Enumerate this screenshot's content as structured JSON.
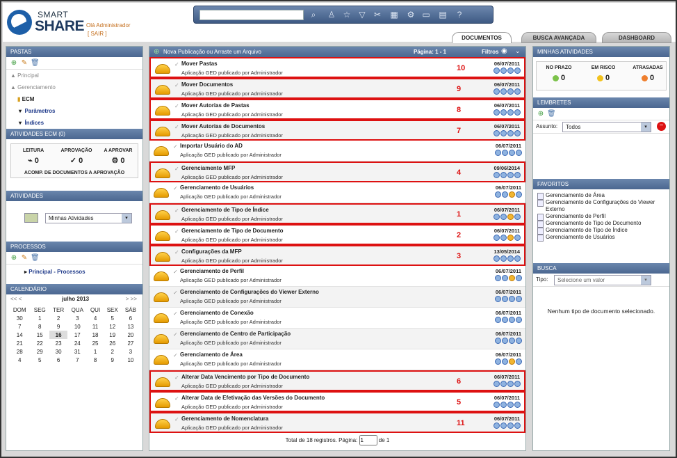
{
  "header": {
    "logo_top": "SMART",
    "logo_bottom": "SHARE",
    "greeting": "Olá Administrador",
    "logout": "[ SAIR ]"
  },
  "tabs": [
    "DOCUMENTOS",
    "BUSCA AVANÇADA",
    "DASHBOARD"
  ],
  "left": {
    "pastas_title": "PASTAS",
    "tree": [
      "Principal",
      "Gerenciamento",
      "ECM",
      "Parâmetros",
      "Índices"
    ],
    "ecm_title": "ATIVIDADES ECM (0)",
    "ecm_stats": [
      {
        "label": "LEITURA",
        "value": "0"
      },
      {
        "label": "APROVAÇÃO",
        "value": "0"
      },
      {
        "label": "A APROVAR",
        "value": "0"
      }
    ],
    "ecm_footer": "ACOMP. DE DOCUMENTOS A APROVAÇÃO",
    "atividades_title": "ATIVIDADES",
    "atividades_select": "Minhas Atividades",
    "processos_title": "PROCESSOS",
    "processos_item": "Principal - Processos",
    "calendario_title": "CALENDÁRIO",
    "cal_month": "julho 2013",
    "cal_prev": "<< <",
    "cal_next": "> >>",
    "cal_days": [
      "DOM",
      "SEG",
      "TER",
      "QUA",
      "QUI",
      "SEX",
      "SÁB"
    ],
    "cal_weeks": [
      [
        "30",
        "1",
        "2",
        "3",
        "4",
        "5",
        "6"
      ],
      [
        "7",
        "8",
        "9",
        "10",
        "11",
        "12",
        "13"
      ],
      [
        "14",
        "15",
        "16",
        "17",
        "18",
        "19",
        "20"
      ],
      [
        "21",
        "22",
        "23",
        "24",
        "25",
        "26",
        "27"
      ],
      [
        "28",
        "29",
        "30",
        "31",
        "1",
        "2",
        "3"
      ],
      [
        "4",
        "5",
        "6",
        "7",
        "8",
        "9",
        "10"
      ]
    ],
    "cal_today": "16"
  },
  "main": {
    "new_pub": "Nova Publicação ou Arraste um Arquivo",
    "page_label": "Página:  1 - 1",
    "filters": "Filtros",
    "rows": [
      {
        "title": "Mover Pastas",
        "sub": "Aplicação GED publicado por Administrador",
        "num": "10",
        "date": "06/07/2011",
        "hl": true,
        "warn": false
      },
      {
        "title": "Mover Documentos",
        "sub": "Aplicação GED publicado por Administrador",
        "num": "9",
        "date": "06/07/2011",
        "hl": true,
        "warn": false
      },
      {
        "title": "Mover Autorias de Pastas",
        "sub": "Aplicação GED publicado por Administrador",
        "num": "8",
        "date": "06/07/2011",
        "hl": true,
        "warn": false
      },
      {
        "title": "Mover Autorias de Documentos",
        "sub": "Aplicação GED publicado por Administrador",
        "num": "7",
        "date": "06/07/2011",
        "hl": true,
        "warn": false
      },
      {
        "title": "Importar Usuário do AD",
        "sub": "Aplicação GED publicado por Administrador",
        "num": "",
        "date": "06/07/2011",
        "hl": false,
        "warn": false
      },
      {
        "title": "Gerenciamento MFP",
        "sub": "Aplicação GED publicado por Administrador",
        "num": "4",
        "date": "09/06/2014",
        "hl": true,
        "warn": false
      },
      {
        "title": "Gerenciamento de Usuários",
        "sub": "Aplicação GED publicado por Administrador",
        "num": "",
        "date": "06/07/2011",
        "hl": false,
        "warn": true
      },
      {
        "title": "Gerenciamento de Tipo de Índice",
        "sub": "Aplicação GED publicado por Administrador",
        "num": "1",
        "date": "06/07/2011",
        "hl": true,
        "warn": true
      },
      {
        "title": "Gerenciamento de Tipo de Documento",
        "sub": "Aplicação GED publicado por Administrador",
        "num": "2",
        "date": "06/07/2011",
        "hl": true,
        "warn": true
      },
      {
        "title": "Configurações da MFP",
        "sub": "Aplicação GED publicado por Administrador",
        "num": "3",
        "date": "13/05/2014",
        "hl": true,
        "warn": false
      },
      {
        "title": "Gerenciamento de Perfil",
        "sub": "Aplicação GED publicado por Administrador",
        "num": "",
        "date": "06/07/2011",
        "hl": false,
        "warn": true
      },
      {
        "title": "Gerenciamento de Configurações do Viewer Externo",
        "sub": "Aplicação GED publicado por Administrador",
        "num": "",
        "date": "06/07/2011",
        "hl": false,
        "warn": false
      },
      {
        "title": "Gerenciamento de Conexão",
        "sub": "Aplicação GED publicado por Administrador",
        "num": "",
        "date": "06/07/2011",
        "hl": false,
        "warn": false
      },
      {
        "title": "Gerenciamento de Centro de Participação",
        "sub": "Aplicação GED publicado por Administrador",
        "num": "",
        "date": "06/07/2011",
        "hl": false,
        "warn": false
      },
      {
        "title": "Gerenciamento de Área",
        "sub": "Aplicação GED publicado por Administrador",
        "num": "",
        "date": "06/07/2011",
        "hl": false,
        "warn": true
      },
      {
        "title": "Alterar Data Vencimento por Tipo de Documento",
        "sub": "Aplicação GED publicado por Administrador",
        "num": "6",
        "date": "06/07/2011",
        "hl": true,
        "warn": false
      },
      {
        "title": "Alterar Data de Efetivação das Versões do Documento",
        "sub": "Aplicação GED publicado por Administrador",
        "num": "5",
        "date": "06/07/2011",
        "hl": true,
        "warn": false
      },
      {
        "title": "Gerenciamento de Nomenclatura",
        "sub": "Aplicação GED publicado por Administrador",
        "num": "11",
        "date": "06/07/2011",
        "hl": true,
        "warn": false
      }
    ],
    "footer_text": "Total de 18 registros. Página:",
    "footer_page": "1",
    "footer_of": "de 1"
  },
  "right": {
    "minhas_title": "MINHAS ATIVIDADES",
    "minhas": [
      {
        "label": "NO PRAZO",
        "value": "0",
        "color": "#7cc24a"
      },
      {
        "label": "EM RISCO",
        "value": "0",
        "color": "#f2c21e"
      },
      {
        "label": "ATRASADAS",
        "value": "0",
        "color": "#ef7f2e"
      }
    ],
    "lembretes_title": "LEMBRETES",
    "assunto_label": "Assunto:",
    "assunto_value": "Todos",
    "favoritos_title": "FAVORITOS",
    "favoritos": [
      "Gerenciamento de Área",
      "Gerenciamento de Configurações do Viewer Externo",
      "Gerenciamento de Perfil",
      "Gerenciamento de Tipo de Documento",
      "Gerenciamento de Tipo de Índice",
      "Gerenciamento de Usuários"
    ],
    "busca_title": "BUSCA",
    "tipo_label": "Tipo:",
    "tipo_placeholder": "Selecione um valor",
    "busca_empty": "Nenhum tipo de documento selecionado."
  }
}
